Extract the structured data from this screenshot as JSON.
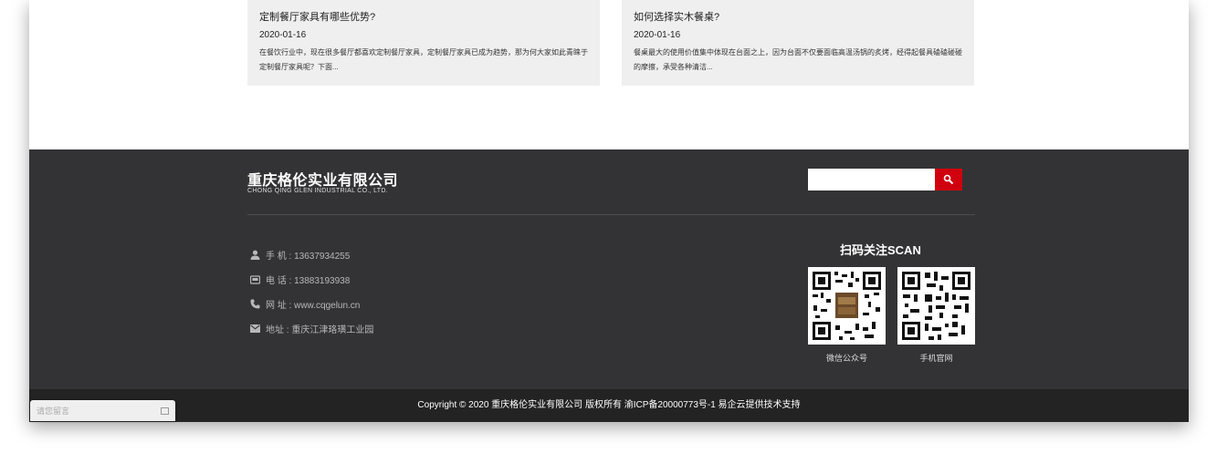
{
  "news": [
    {
      "title": "定制餐厅家具有哪些优势?",
      "date": "2020-01-16",
      "excerpt": "在餐饮行业中，现在很多餐厅都喜欢定制餐厅家具，定制餐厅家具已成为趋势，那为何大家如此青睐于定制餐厅家具呢？下面..."
    },
    {
      "title": "如何选择实木餐桌?",
      "date": "2020-01-16",
      "excerpt": "餐桌最大的使用价值集中体现在台面之上，因为台面不仅要面临高温汤锅的炙烤，经得起餐具磕磕碰碰的摩擦，承受各种清洁..."
    }
  ],
  "footer": {
    "brand_cn": "重庆格伦实业有限公司",
    "brand_en": "CHONG QING GLEN INDUSTRIAL CO., LTD.",
    "search_placeholder": "",
    "contacts": [
      {
        "icon": "user-icon",
        "text": "手 机 : 13637934255"
      },
      {
        "icon": "phone-desk-icon",
        "text": "电 话 : 13883193938"
      },
      {
        "icon": "phone-icon",
        "text": "网 址 : www.cqgelun.cn"
      },
      {
        "icon": "mail-icon",
        "text": "地址 : 重庆江津珞璜工业园"
      }
    ],
    "scan_title": "扫码关注SCAN",
    "qr_labels": [
      "微信公众号",
      "手机官网"
    ],
    "copyright": "Copyright © 2020 重庆格伦实业有限公司 版权所有 渝ICP备20000773号-1 易企云提供技术支持"
  },
  "message_tab": {
    "label": "请您留言"
  },
  "colors": {
    "footer_bg": "#333335",
    "copyright_bg": "#232324",
    "accent_red": "#d0000f",
    "news_card_bg": "#efefef"
  }
}
